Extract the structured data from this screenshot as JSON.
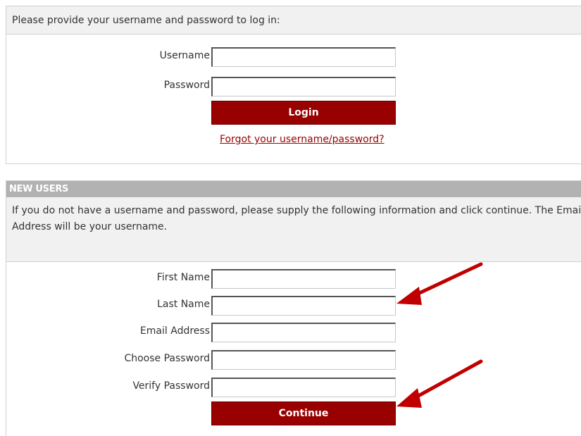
{
  "login": {
    "intro": "Please provide your username and password to log in:",
    "username_label": "Username",
    "username_value": "",
    "password_label": "Password",
    "password_value": "",
    "login_button": "Login",
    "forgot_link": "Forgot your username/password?"
  },
  "new_users": {
    "header": "NEW USERS",
    "intro": "If you do not have a username and password, please supply the following information and click continue. The Email Address will be your username.",
    "fields": [
      {
        "label": "First Name",
        "value": ""
      },
      {
        "label": "Last Name",
        "value": ""
      },
      {
        "label": "Email Address",
        "value": ""
      },
      {
        "label": "Choose Password",
        "value": ""
      },
      {
        "label": "Verify Password",
        "value": ""
      }
    ],
    "continue_button": "Continue"
  },
  "annotations": {
    "arrow_color": "#c00000",
    "arrows": [
      "arrow-to-last-name",
      "arrow-to-continue"
    ]
  },
  "colors": {
    "button_bg": "#990000",
    "header_bg": "#b2b2b2",
    "intro_bg": "#f1f1f1",
    "link": "#990000"
  }
}
